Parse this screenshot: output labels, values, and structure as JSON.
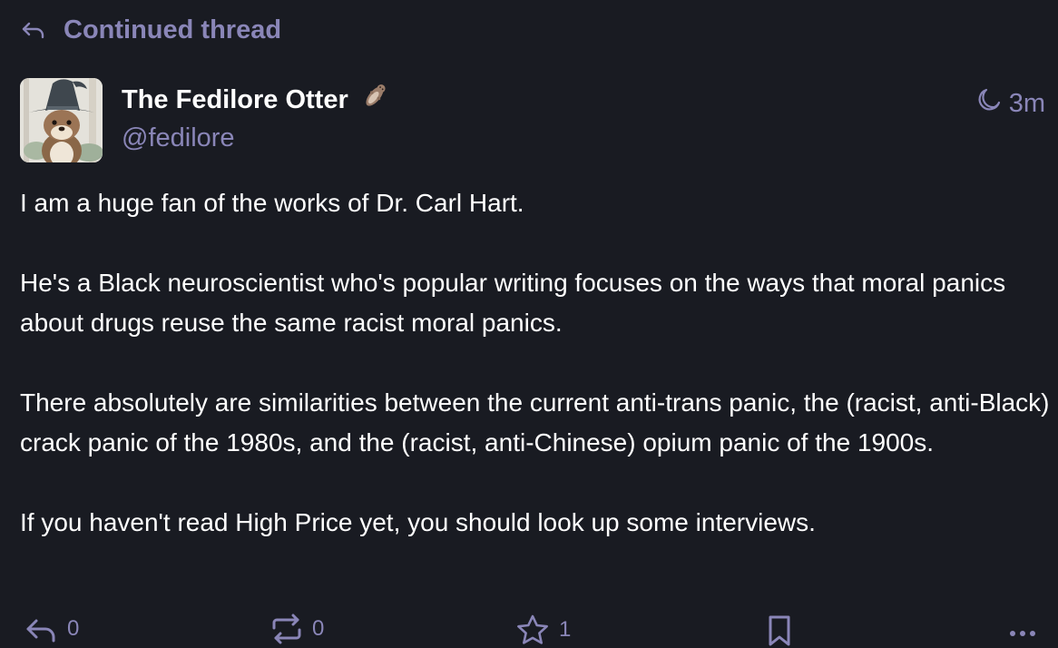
{
  "thread_header": {
    "label": "Continued thread"
  },
  "author": {
    "display_name": "The Fedilore Otter",
    "handle": "@fedilore"
  },
  "post": {
    "relative_time": "3m",
    "visibility_icon": "moon-icon",
    "paragraphs": [
      "I am a huge fan of the works of Dr. Carl Hart.",
      "He's a Black neuroscientist who's popular writing focuses on the ways that moral panics about drugs reuse the same racist moral panics.",
      "There absolutely are similarities between the current anti-trans panic, the (racist, anti-Black) crack panic of the 1980s, and the (racist, anti-Chinese) opium panic of the 1900s.",
      "If you haven't read High Price yet, you should look up some interviews."
    ]
  },
  "actions": {
    "reply_count": "0",
    "boost_count": "0",
    "favourite_count": "1"
  },
  "colors": {
    "background": "#191b22",
    "muted": "#8a86b8",
    "text": "#ffffff"
  }
}
